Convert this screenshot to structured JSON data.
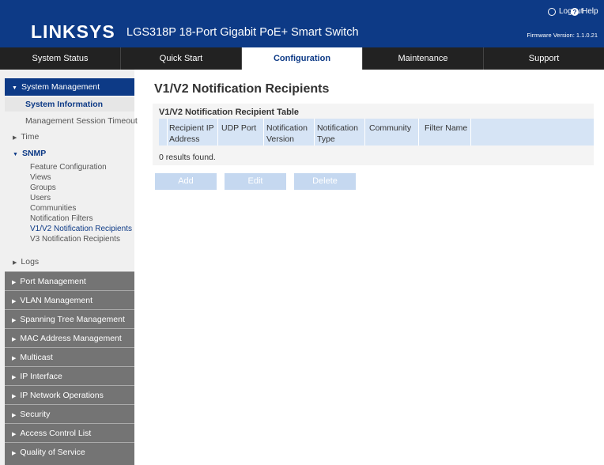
{
  "header": {
    "logo": "LINKSYS",
    "product": "LGS318P 18-Port Gigabit PoE+ Smart Switch",
    "logout": "Logout",
    "help": "Help",
    "firmware": "Firmware Version: 1.1.0.21"
  },
  "nav": {
    "items": [
      "System Status",
      "Quick Start",
      "Configuration",
      "Maintenance",
      "Support"
    ],
    "active": "Configuration"
  },
  "sidebar": {
    "system_management": "System Management",
    "system_information": "System Information",
    "management_session_timeout": "Management Session Timeout",
    "time": "Time",
    "snmp": "SNMP",
    "snmp_items": [
      "Feature Configuration",
      "Views",
      "Groups",
      "Users",
      "Communities",
      "Notification Filters",
      "V1/V2 Notification Recipients",
      "V3 Notification Recipients"
    ],
    "logs": "Logs",
    "sections": [
      "Port Management",
      "VLAN Management",
      "Spanning Tree Management",
      "MAC Address Management",
      "Multicast",
      "IP Interface",
      "IP Network Operations",
      "Security",
      "Access Control List",
      "Quality of Service"
    ]
  },
  "main": {
    "title": "V1/V2 Notification Recipients",
    "table": {
      "caption": "V1/V2 Notification Recipient Table",
      "headers": [
        [
          "Recipient IP",
          "Address"
        ],
        [
          "UDP Port",
          ""
        ],
        [
          "Notification",
          "Version"
        ],
        [
          "Notification",
          "Type"
        ],
        [
          "Community",
          ""
        ],
        [
          "Filter Name",
          ""
        ]
      ],
      "empty_text": "0 results found."
    },
    "buttons": {
      "add": "Add",
      "edit": "Edit",
      "delete": "Delete"
    }
  },
  "colors": {
    "brand_blue": "#0d3a86",
    "nav_bg": "#222222",
    "sidebar_section_bg": "#747474",
    "table_header_bg": "#d6e4f5",
    "button_disabled_bg": "#c5d8f0"
  }
}
